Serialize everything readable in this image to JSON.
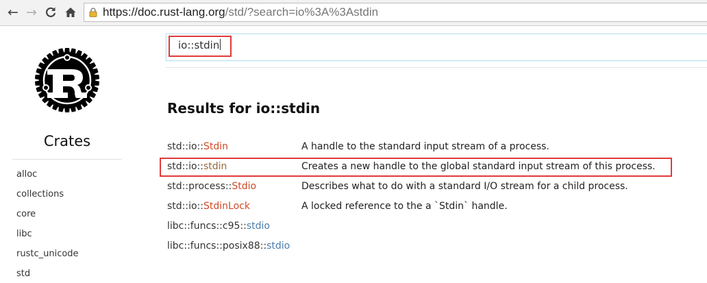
{
  "browser": {
    "url_main": "https://doc.rust-lang.org",
    "url_rest": "/std/?search=io%3A%3Astdin",
    "icons": [
      "back-arrow-icon",
      "forward-arrow-icon",
      "reload-icon",
      "home-icon",
      "lock-icon"
    ]
  },
  "sidebar": {
    "title": "Crates",
    "crates": [
      "alloc",
      "collections",
      "core",
      "libc",
      "rustc_unicode",
      "std"
    ]
  },
  "search": {
    "value": "io::stdin"
  },
  "results": {
    "heading": "Results for io::stdin",
    "rows": [
      {
        "prefix": "std::io::",
        "name": "Stdin",
        "kind": "struct",
        "desc": "A handle to the standard input stream of a process."
      },
      {
        "prefix": "std::io::",
        "name": "stdin",
        "kind": "fn",
        "desc": "Creates a new handle to the global standard input stream of this process."
      },
      {
        "prefix": "std::process::",
        "name": "Stdio",
        "kind": "struct",
        "desc": "Describes what to do with a standard I/O stream for a child process."
      },
      {
        "prefix": "std::io::",
        "name": "StdinLock",
        "kind": "struct",
        "desc": "A locked reference to the a `Stdin` handle."
      },
      {
        "prefix": "libc::funcs::c95::",
        "name": "stdio",
        "kind": "mod",
        "desc": ""
      },
      {
        "prefix": "libc::funcs::posix88::",
        "name": "stdio",
        "kind": "mod",
        "desc": ""
      }
    ]
  },
  "colors": {
    "highlight": "#e03a3a",
    "struct": "#d04a26",
    "module": "#4b7cab"
  }
}
